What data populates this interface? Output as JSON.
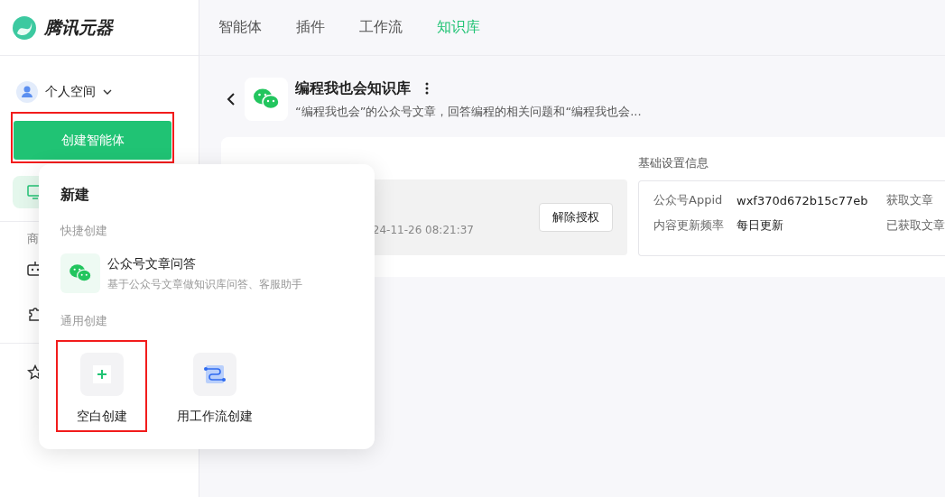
{
  "brand": {
    "name": "腾讯元器"
  },
  "nav": [
    {
      "label": "智能体",
      "selected": false
    },
    {
      "label": "插件",
      "selected": false
    },
    {
      "label": "工作流",
      "selected": false
    },
    {
      "label": "知识库",
      "selected": true
    }
  ],
  "sidebar": {
    "space": "个人空间",
    "create_button": "创建智能体",
    "section_label": "商",
    "items": [
      {
        "kind": "monitor",
        "selected": true
      },
      {
        "kind": "robot",
        "selected": false
      },
      {
        "kind": "puzzle",
        "selected": false
      },
      {
        "kind": "star",
        "selected": false
      }
    ]
  },
  "knowledge_base": {
    "title": "编程我也会知识库",
    "description": "“编程我也会”的公众号文章，回答编程的相关问题和“编程我也会...",
    "auth_time": "24-11-26 08:21:37",
    "revoke_button": "解除授权",
    "settings_title": "基础设置信息",
    "settings": [
      {
        "label": "公众号Appid",
        "value": "wxf370d672b15c77eb"
      },
      {
        "label": "内容更新频率",
        "value": "每日更新"
      }
    ],
    "settings_col2": [
      "获取文章",
      "已获取文章"
    ]
  },
  "popup": {
    "title": "新建",
    "quick_label": "快捷创建",
    "quick_item": {
      "title": "公众号文章问答",
      "subtitle": "基于公众号文章做知识库问答、客服助手"
    },
    "general_label": "通用创建",
    "options": [
      {
        "kind": "blank",
        "label": "空白创建",
        "highlighted": true
      },
      {
        "kind": "workflow",
        "label": "用工作流创建",
        "highlighted": false
      }
    ]
  }
}
